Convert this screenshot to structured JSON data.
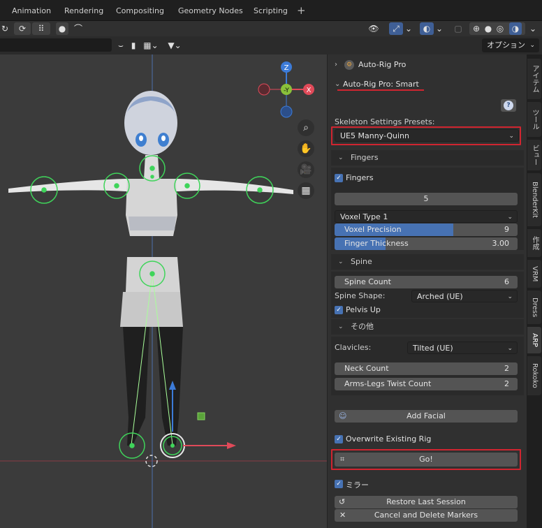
{
  "workspace_tabs": [
    "Animation",
    "Rendering",
    "Compositing",
    "Geometry Nodes",
    "Scripting"
  ],
  "workspace_add": "+",
  "options_label": "オプション",
  "panels": {
    "arp_title": "Auto-Rig Pro",
    "smart_title": "Auto-Rig Pro: Smart"
  },
  "help_icon": "?",
  "presets": {
    "label": "Skeleton Settings Presets:",
    "value": "UE5 Manny-Quinn"
  },
  "fingers": {
    "header": "Fingers",
    "checkbox_label": "Fingers",
    "count": "5",
    "voxel_type": "Voxel Type 1",
    "voxel_precision_label": "Voxel Precision",
    "voxel_precision_value": "9",
    "voxel_precision_fraction": 0.65,
    "thickness_label": "Finger Thickness",
    "thickness_value": "3.00",
    "thickness_fraction": 0.28
  },
  "spine": {
    "header": "Spine",
    "count_label": "Spine Count",
    "count_value": "6",
    "shape_label": "Spine Shape:",
    "shape_value": "Arched (UE)",
    "pelvis_label": "Pelvis Up"
  },
  "other": {
    "header": "その他",
    "clavicles_label": "Clavicles:",
    "clavicles_value": "Tilted (UE)",
    "neck_label": "Neck Count",
    "neck_value": "2",
    "twist_label": "Arms-Legs Twist Count",
    "twist_value": "2"
  },
  "actions": {
    "add_facial": "Add Facial",
    "overwrite": "Overwrite Existing Rig",
    "go": "Go!",
    "mirror": "ミラー",
    "restore": "Restore Last Session",
    "cancel": "Cancel and Delete Markers"
  },
  "gizmo": {
    "z": "Z",
    "y": "-Y",
    "x": "X"
  },
  "vertical_tabs": [
    "アイテム",
    "ツール",
    "ビュー",
    "BlenderKit",
    "作成",
    "VRM",
    "Dress",
    "ARP",
    "Rokoko"
  ],
  "colors": {
    "accent": "#4772b3",
    "highlight": "#d02530",
    "marker": "#3fd45a"
  }
}
